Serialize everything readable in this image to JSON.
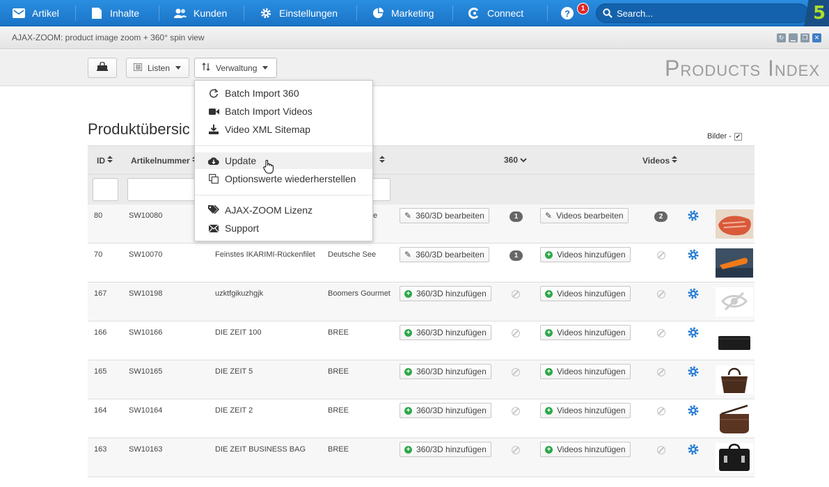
{
  "topnav": {
    "items": [
      {
        "label": "Artikel",
        "icon": "article-icon"
      },
      {
        "label": "Inhalte",
        "icon": "content-icon"
      },
      {
        "label": "Kunden",
        "icon": "customers-icon"
      },
      {
        "label": "Einstellungen",
        "icon": "gear-icon"
      },
      {
        "label": "Marketing",
        "icon": "pie-chart-icon"
      },
      {
        "label": "Connect",
        "icon": "connect-icon"
      }
    ],
    "help_label": "?",
    "notification_count": "1",
    "search_placeholder": "Search...",
    "logo_text": "5",
    "accent_color": "#1a74c7",
    "logo_color": "#aedc2a"
  },
  "window": {
    "title": "AJAX-ZOOM: product image zoom + 360° spin view"
  },
  "toolbar": {
    "listen_label": "Listen",
    "verwaltung_label": "Verwaltung",
    "page_title": "Products Index"
  },
  "dropdown": {
    "items": [
      {
        "label": "Batch Import 360",
        "icon": "refresh-icon"
      },
      {
        "label": "Batch Import Videos",
        "icon": "video-camera-icon"
      },
      {
        "label": "Video XML Sitemap",
        "icon": "sitemap-download-icon"
      },
      {
        "label": "Update",
        "icon": "cloud-download-icon"
      },
      {
        "label": "Optionswerte wiederherstellen",
        "icon": "copy-icon"
      },
      {
        "label": "AJAX-ZOOM Lizenz",
        "icon": "tags-icon"
      },
      {
        "label": "Support",
        "icon": "envelope-icon"
      }
    ]
  },
  "main": {
    "heading": "Produktübersic",
    "bilder_label": "Bilder -",
    "columns": {
      "id": "ID",
      "artikelnummer": "Artikelnummer",
      "spin": "360",
      "videos": "Videos"
    },
    "rows": [
      {
        "id": "80",
        "sku": "SW10080",
        "name": "",
        "supplier": "e",
        "spin_action": "360/3D bearbeiten",
        "spin_count": "1",
        "video_action": "Videos bearbeiten",
        "video_count": "2"
      },
      {
        "id": "70",
        "sku": "SW10070",
        "name": "Feinstes IKARIMI-Rückenfilet",
        "supplier": "Deutsche See",
        "spin_action": "360/3D bearbeiten",
        "spin_count": "1",
        "video_action": "Videos hinzufügen",
        "video_count": ""
      },
      {
        "id": "167",
        "sku": "SW10198",
        "name": "uzktfgikuzhgjk",
        "supplier": "Boomers Gourmet",
        "spin_action": "360/3D hinzufügen",
        "spin_count": "",
        "video_action": "Videos hinzufügen",
        "video_count": ""
      },
      {
        "id": "166",
        "sku": "SW10166",
        "name": "DIE ZEIT 100",
        "supplier": "BREE",
        "spin_action": "360/3D hinzufügen",
        "spin_count": "",
        "video_action": "Videos hinzufügen",
        "video_count": ""
      },
      {
        "id": "165",
        "sku": "SW10165",
        "name": "DIE ZEIT 5",
        "supplier": "BREE",
        "spin_action": "360/3D hinzufügen",
        "spin_count": "",
        "video_action": "Videos hinzufügen",
        "video_count": ""
      },
      {
        "id": "164",
        "sku": "SW10164",
        "name": "DIE ZEIT 2",
        "supplier": "BREE",
        "spin_action": "360/3D hinzufügen",
        "spin_count": "",
        "video_action": "Videos hinzufügen",
        "video_count": ""
      },
      {
        "id": "163",
        "sku": "SW10163",
        "name": "DIE ZEIT BUSINESS BAG",
        "supplier": "BREE",
        "spin_action": "360/3D hinzufügen",
        "spin_count": "",
        "video_action": "Videos hinzufügen",
        "video_count": ""
      }
    ]
  }
}
